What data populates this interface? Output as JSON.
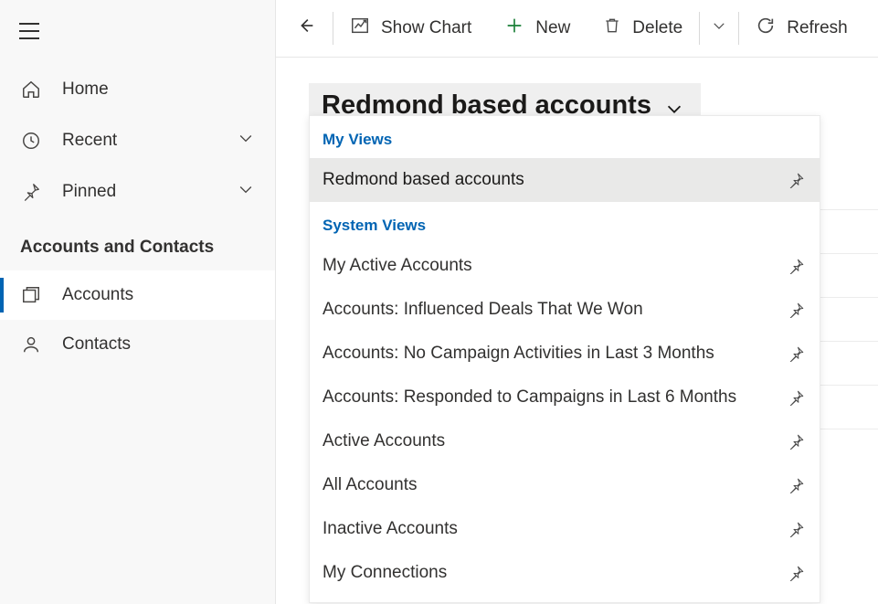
{
  "sidebar": {
    "home": "Home",
    "recent": "Recent",
    "pinned": "Pinned",
    "section": "Accounts and Contacts",
    "accounts": "Accounts",
    "contacts": "Contacts"
  },
  "toolbar": {
    "show_chart": "Show Chart",
    "new": "New",
    "delete": "Delete",
    "refresh": "Refresh"
  },
  "view": {
    "current": "Redmond based accounts",
    "my_views_header": "My Views",
    "system_views_header": "System Views",
    "my_views": [
      "Redmond based accounts"
    ],
    "system_views": [
      "My Active Accounts",
      "Accounts: Influenced Deals That We Won",
      "Accounts: No Campaign Activities in Last 3 Months",
      "Accounts: Responded to Campaigns in Last 6 Months",
      "Active Accounts",
      "All Accounts",
      "Inactive Accounts",
      "My Connections"
    ]
  }
}
